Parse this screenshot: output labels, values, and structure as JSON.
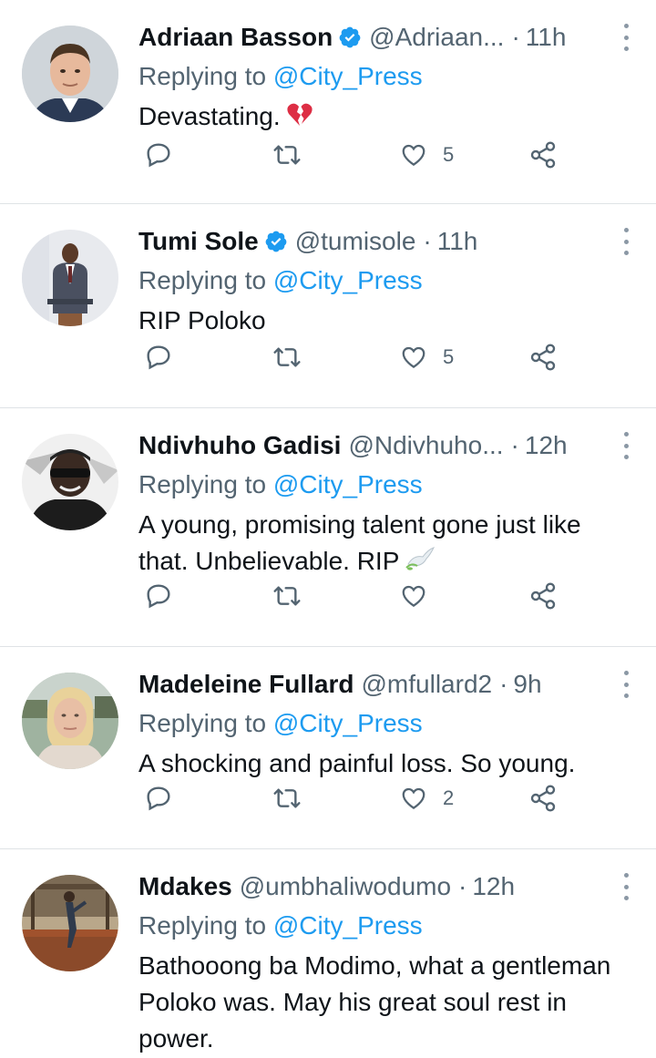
{
  "tweets": [
    {
      "name": "Adriaan Basson",
      "verified": true,
      "handle": "@Adriaan...",
      "time": "11h",
      "replying_prefix": "Replying to ",
      "replying_to": "@City_Press",
      "text": "Devastating.",
      "emoji": "broken-heart-icon",
      "likes": "5"
    },
    {
      "name": "Tumi Sole",
      "verified": true,
      "handle": "@tumisole",
      "time": "11h",
      "replying_prefix": "Replying to ",
      "replying_to": "@City_Press",
      "text": "RIP Poloko",
      "likes": "5"
    },
    {
      "name": "Ndivhuho Gadisi",
      "verified": false,
      "handle": "@Ndivhuho...",
      "time": "12h",
      "replying_prefix": "Replying to ",
      "replying_to": "@City_Press",
      "text": "A young, promising talent gone just like that. Unbelievable. RIP",
      "emoji": "dove-icon",
      "likes": ""
    },
    {
      "name": "Madeleine Fullard",
      "verified": false,
      "handle": "@mfullard2",
      "time": "9h",
      "replying_prefix": "Replying to ",
      "replying_to": "@City_Press",
      "text": "A shocking and painful loss. So young.",
      "likes": "2"
    },
    {
      "name": "Mdakes",
      "verified": false,
      "handle": "@umbhaliwodumo",
      "time": "12h",
      "replying_prefix": "Replying to ",
      "replying_to": "@City_Press",
      "text": "Bathooong ba Modimo, what a gentleman Poloko was. May his great soul rest in power."
    }
  ],
  "separator": "·",
  "colors": {
    "text": "#0f1419",
    "secondary": "#536471",
    "link": "#1d9bf0",
    "verified": "#1d9bf0",
    "divider": "#dfe3e6"
  }
}
